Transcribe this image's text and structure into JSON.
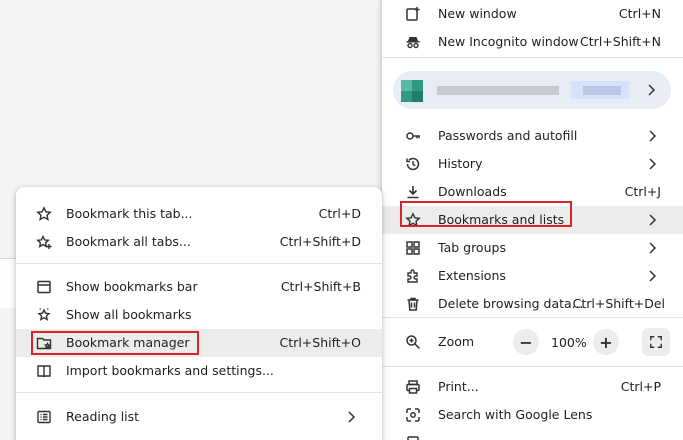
{
  "main_menu": {
    "new_window": {
      "label": "New window",
      "shortcut": "Ctrl+N"
    },
    "new_incognito": {
      "label": "New Incognito window",
      "shortcut": "Ctrl+Shift+N"
    },
    "passwords": {
      "label": "Passwords and autofill"
    },
    "history": {
      "label": "History"
    },
    "downloads": {
      "label": "Downloads",
      "shortcut": "Ctrl+J"
    },
    "bookmarks_lists": {
      "label": "Bookmarks and lists"
    },
    "tab_groups": {
      "label": "Tab groups"
    },
    "extensions": {
      "label": "Extensions"
    },
    "delete_browsing": {
      "label": "Delete browsing data...",
      "shortcut": "Ctrl+Shift+Del"
    },
    "zoom": {
      "label": "Zoom",
      "minus": "−",
      "value": "100%",
      "plus": "+"
    },
    "print": {
      "label": "Print...",
      "shortcut": "Ctrl+P"
    },
    "google_lens": {
      "label": "Search with Google Lens"
    }
  },
  "bookmarks_submenu": {
    "bookmark_tab": {
      "label": "Bookmark this tab...",
      "shortcut": "Ctrl+D"
    },
    "bookmark_all": {
      "label": "Bookmark all tabs...",
      "shortcut": "Ctrl+Shift+D"
    },
    "show_bar": {
      "label": "Show bookmarks bar",
      "shortcut": "Ctrl+Shift+B"
    },
    "show_all": {
      "label": "Show all bookmarks"
    },
    "manager": {
      "label": "Bookmark manager",
      "shortcut": "Ctrl+Shift+O"
    },
    "import": {
      "label": "Import bookmarks and settings..."
    },
    "reading_list": {
      "label": "Reading list"
    }
  },
  "colors": {
    "highlight_box": "#d8232a",
    "hover_row": "#ececec",
    "profile_pill": "#e8ecf4"
  }
}
